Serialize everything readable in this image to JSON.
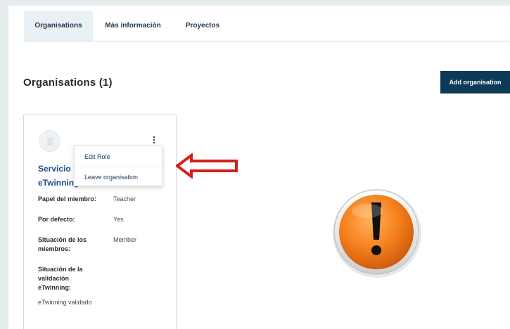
{
  "tabs": [
    {
      "label": "Organisations",
      "active": true
    },
    {
      "label": "Más información",
      "active": false
    },
    {
      "label": "Proyectos",
      "active": false
    }
  ],
  "section": {
    "title": "Organisations (1)",
    "add_button": "Add organisation"
  },
  "card": {
    "name_line1": "Servicio",
    "name_line2": "eTwinning",
    "fields": [
      {
        "label": "Papel del miembro:",
        "value": "Teacher"
      },
      {
        "label": "Por defecto:",
        "value": "Yes"
      },
      {
        "label": "Situación de los miembros:",
        "value": "Member"
      },
      {
        "label": "Situación de la validación eTwinning:",
        "value": ""
      }
    ],
    "validation_value": "eTwinning validado"
  },
  "menu": {
    "items": [
      "Edit Role",
      "Leave organisation"
    ]
  },
  "icons": {
    "kebab": "kebab-menu-icon",
    "arrow": "left-arrow-icon",
    "warning": "exclamation-warning-icon"
  },
  "colors": {
    "accent": "#0d3a57",
    "link": "#1d4e86",
    "arrow": "#d4201a",
    "warning": "#f07f1e"
  }
}
